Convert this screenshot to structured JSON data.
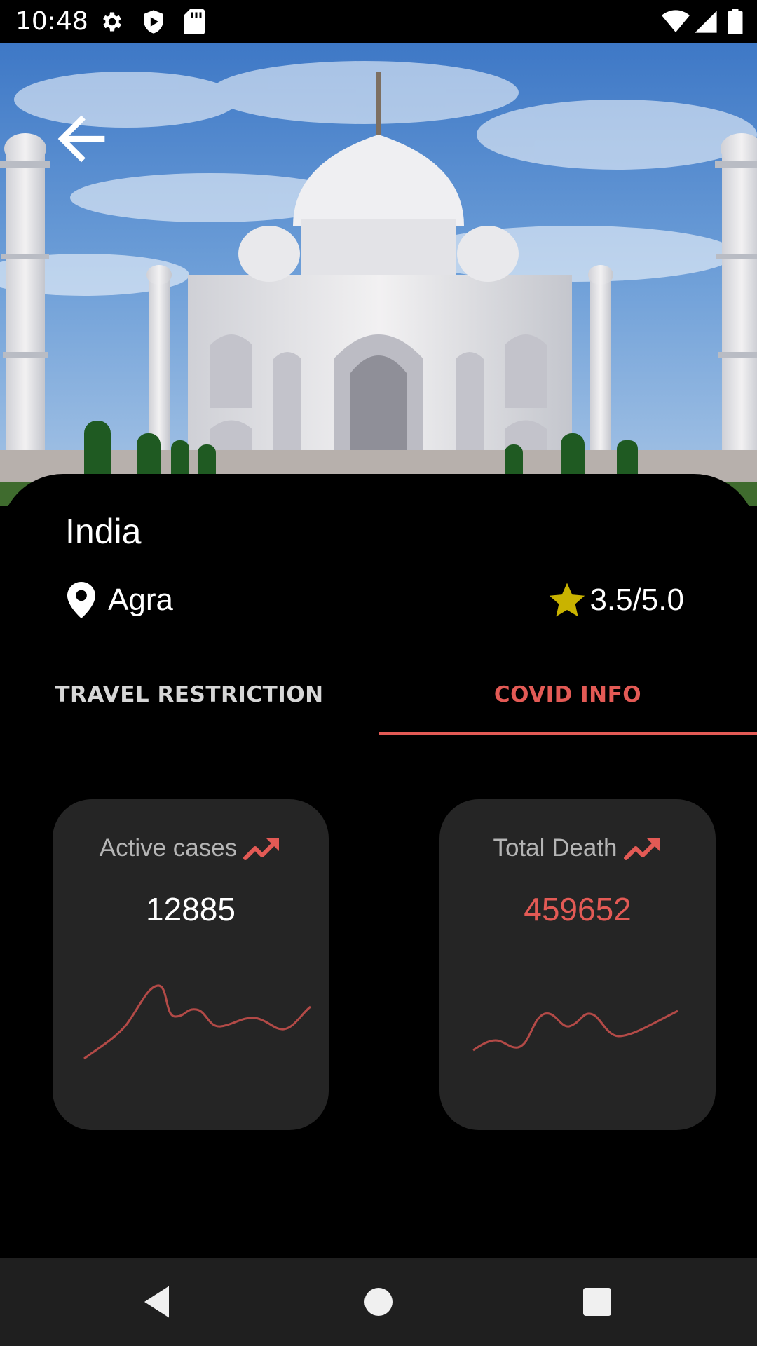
{
  "status_bar": {
    "time": "10:48",
    "icons": [
      "settings-icon",
      "shield-icon",
      "sd-card-icon",
      "wifi-icon",
      "signal-icon",
      "battery-icon"
    ]
  },
  "hero": {
    "image": "taj-mahal-photo",
    "back_icon": "arrow-back-icon"
  },
  "place": {
    "country": "India",
    "location_icon": "location-pin-icon",
    "city": "Agra",
    "rating_icon": "star-icon",
    "rating": "3.5/5.0",
    "rating_color": "#c9b300"
  },
  "tabs": [
    {
      "label": "TRAVEL RESTRICTION",
      "selected": false
    },
    {
      "label": "COVID INFO",
      "selected": true
    }
  ],
  "accent_color": "#e35a55",
  "cards": [
    {
      "title": "Active cases",
      "value": "12885",
      "trend_icon": "trending-up-icon"
    },
    {
      "title": "Total Death",
      "value": "459652",
      "trend_icon": "trending-up-icon"
    }
  ],
  "nav_bar": {
    "buttons": [
      "back-triangle-icon",
      "home-circle-icon",
      "recents-square-icon"
    ]
  }
}
